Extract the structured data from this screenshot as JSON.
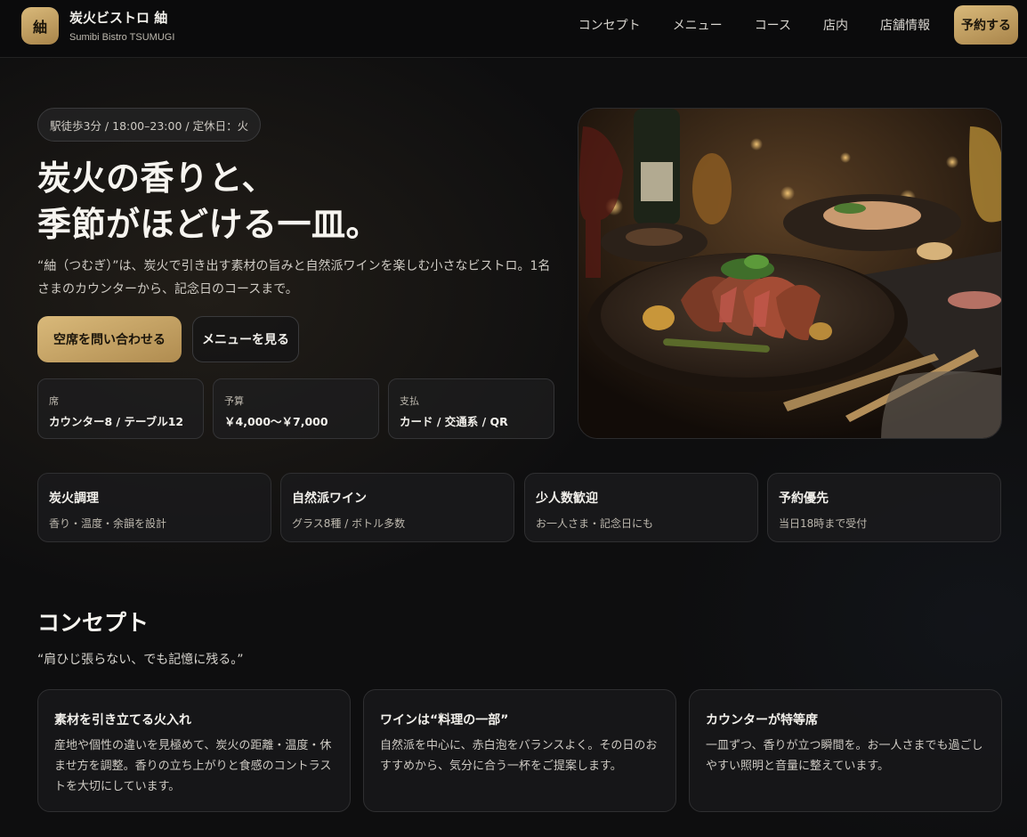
{
  "header": {
    "logo_char": "紬",
    "brand_name": "炭火ビストロ 紬",
    "brand_sub": "Sumibi Bistro TSUMUGI",
    "nav": [
      "コンセプト",
      "メニュー",
      "コース",
      "店内",
      "店舗情報"
    ],
    "reserve_label": "予約する"
  },
  "hero": {
    "pill": "駅徒歩3分 / 18:00–23:00 / 定休日：火",
    "title_line1": "炭火の香りと、",
    "title_line2": "季節がほどける一皿。",
    "description": "“紬（つむぎ）”は、炭火で引き出す素材の旨みと自然派ワインを楽しむ小さなビストロ。1名さまのカウンターから、記念日のコースまで。",
    "primary_button": "空席を問い合わせる",
    "secondary_button": "メニューを見る",
    "info": [
      {
        "label": "席",
        "value": "カウンター8 / テーブル12"
      },
      {
        "label": "予算",
        "value": "￥4,000〜￥7,000"
      },
      {
        "label": "支払",
        "value": "カード / 交通系 / QR"
      }
    ]
  },
  "features": [
    {
      "title": "炭火調理",
      "sub": "香り・温度・余韻を設計"
    },
    {
      "title": "自然派ワイン",
      "sub": "グラス8種 / ボトル多数"
    },
    {
      "title": "少人数歓迎",
      "sub": "お一人さま・記念日にも"
    },
    {
      "title": "予約優先",
      "sub": "当日18時まで受付"
    }
  ],
  "concept": {
    "title": "コンセプト",
    "quote": "“肩ひじ張らない、でも記憶に残る。”",
    "cards": [
      {
        "title": "素材を引き立てる火入れ",
        "body": "産地や個性の違いを見極めて、炭火の距離・温度・休ませ方を調整。香りの立ち上がりと食感のコントラストを大切にしています。"
      },
      {
        "title": "ワインは“料理の一部”",
        "body": "自然派を中心に、赤白泡をバランスよく。その日のおすすめから、気分に合う一杯をご提案します。"
      },
      {
        "title": "カウンターが特等席",
        "body": "一皿ずつ、香りが立つ瞬間を。お一人さまでも過ごしやすい照明と音量に整えています。"
      }
    ]
  },
  "colors": {
    "accent_gold": "#c9a465",
    "background": "#0e0e0f"
  }
}
